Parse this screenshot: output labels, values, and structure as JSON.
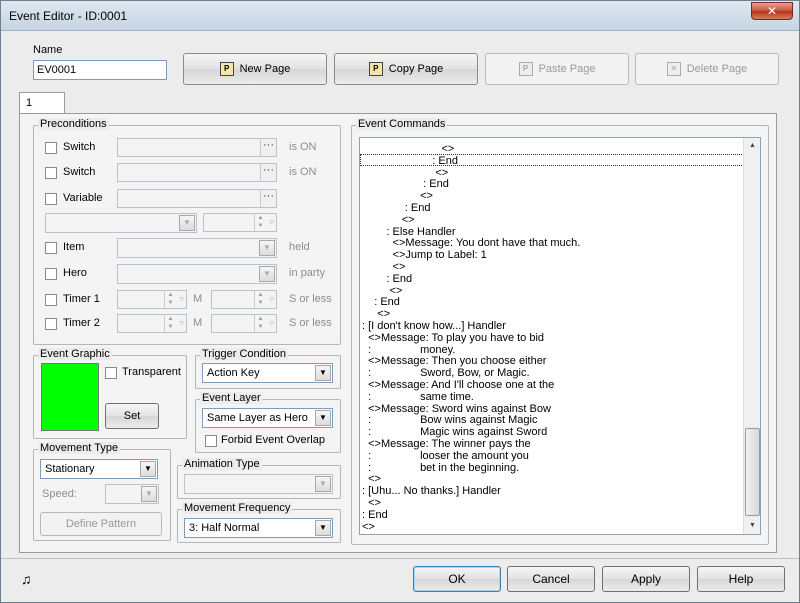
{
  "window": {
    "title": "Event Editor - ID:0001",
    "close_glyph": "✕"
  },
  "name": {
    "label": "Name",
    "value": "EV0001"
  },
  "toolbar": {
    "new_page": "New Page",
    "copy_page": "Copy Page",
    "paste_page": "Paste Page",
    "delete_page": "Delete Page"
  },
  "tabs": [
    {
      "label": "1"
    }
  ],
  "preconditions": {
    "label": "Preconditions",
    "switch1": {
      "label": "Switch",
      "suffix": "is ON"
    },
    "switch2": {
      "label": "Switch",
      "suffix": "is ON"
    },
    "variable": {
      "label": "Variable"
    },
    "item": {
      "label": "Item",
      "suffix": "held"
    },
    "hero": {
      "label": "Hero",
      "suffix": "in party"
    },
    "timer1": {
      "label": "Timer 1",
      "m": "M",
      "suffix": "S or less"
    },
    "timer2": {
      "label": "Timer 2",
      "m": "M",
      "suffix": "S or less"
    }
  },
  "event_graphic": {
    "label": "Event Graphic",
    "transparent": "Transparent",
    "set": "Set",
    "color": "#00ff00"
  },
  "trigger": {
    "label": "Trigger Condition",
    "value": "Action Key"
  },
  "event_layer": {
    "label": "Event Layer",
    "value": "Same Layer as Hero",
    "forbid": "Forbid Event Overlap"
  },
  "movement_type": {
    "label": "Movement Type",
    "value": "Stationary",
    "speed": "Speed:",
    "define": "Define Pattern"
  },
  "animation_type": {
    "label": "Animation Type",
    "value": ""
  },
  "movement_frequency": {
    "label": "Movement Frequency",
    "value": "3: Half Normal"
  },
  "event_commands": {
    "label": "Event Commands",
    "lines": [
      "                          <>",
      "                       : End",
      "                        <>",
      "                    : End",
      "                   <>",
      "              : End",
      "             <>",
      "        : Else Handler",
      "          <>Message: You dont have that much.",
      "          <>Jump to Label: 1",
      "          <>",
      "        : End",
      "         <>",
      "    : End",
      "     <>",
      ": [I don't know how...] Handler",
      "  <>Message: To play you have to bid",
      "  :                money.",
      "  <>Message: Then you choose either",
      "  :                Sword, Bow, or Magic.",
      "  <>Message: And I'll choose one at the",
      "  :                same time.",
      "  <>Message: Sword wins against Bow",
      "  :                Bow wins against Magic",
      "  :                Magic wins against Sword",
      "  <>Message: The winner pays the",
      "  :                looser the amount you",
      "  :                bet in the beginning.",
      "  <>",
      ": [Uhu... No thanks.] Handler",
      "  <>",
      ": End",
      "<>"
    ]
  },
  "footer": {
    "ok": "OK",
    "cancel": "Cancel",
    "apply": "Apply",
    "help": "Help",
    "music_glyph": "♫"
  }
}
